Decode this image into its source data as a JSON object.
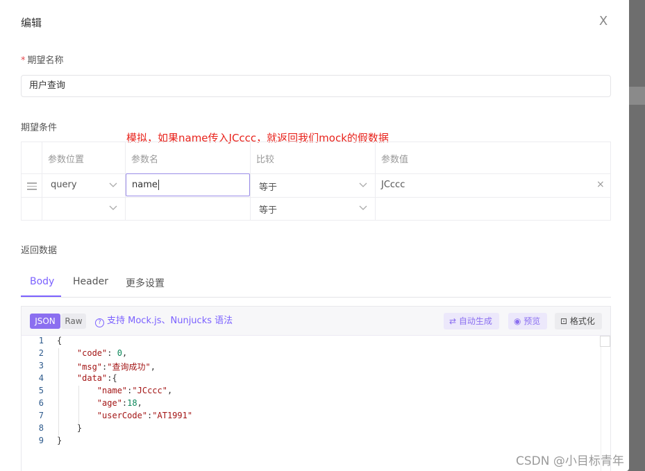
{
  "modal": {
    "title": "编辑",
    "close_glyph": "X"
  },
  "name_field": {
    "required_mark": "*",
    "label": "期望名称",
    "value": "用户查询"
  },
  "conditions": {
    "label": "期望条件",
    "annotation": "模拟，如果name传入JCccc，就返回我们mock的假数据",
    "headers": [
      "参数位置",
      "参数名",
      "比较",
      "参数值"
    ],
    "rows": [
      {
        "position": "query",
        "name": "name",
        "compare": "等于",
        "value": "JCccc"
      },
      {
        "position": "",
        "name": "",
        "compare": "等于",
        "value": ""
      }
    ]
  },
  "response": {
    "label": "返回数据",
    "tabs": [
      {
        "label": "Body",
        "active": true
      },
      {
        "label": "Header",
        "active": false
      },
      {
        "label": "更多设置",
        "active": false
      }
    ],
    "toolbar": {
      "json_label": "JSON",
      "raw_label": "Raw",
      "support_text": "支持 Mock.js、Nunjucks 语法",
      "auto_label": "自动生成",
      "preview_label": "预览",
      "format_label": "格式化"
    },
    "code_lines": [
      {
        "n": "1",
        "text": "{"
      },
      {
        "n": "2",
        "text": "    \"code\": 0,"
      },
      {
        "n": "3",
        "text": "    \"msg\":\"查询成功\","
      },
      {
        "n": "4",
        "text": "    \"data\":{"
      },
      {
        "n": "5",
        "text": "        \"name\":\"JCccc\","
      },
      {
        "n": "6",
        "text": "        \"age\":18,"
      },
      {
        "n": "7",
        "text": "        \"userCode\":\"AT1991\""
      },
      {
        "n": "8",
        "text": "    }"
      },
      {
        "n": "9",
        "text": "}"
      }
    ]
  },
  "watermark": "CSDN @小目标青年",
  "colors": {
    "accent": "#7b61ff",
    "annotation": "#e8221b",
    "required": "#e5484d"
  },
  "icons": [
    "close-icon",
    "drag-handle-icon",
    "chevron-down-icon",
    "clear-icon",
    "question-circle-icon",
    "sync-icon",
    "eye-icon",
    "format-icon"
  ]
}
